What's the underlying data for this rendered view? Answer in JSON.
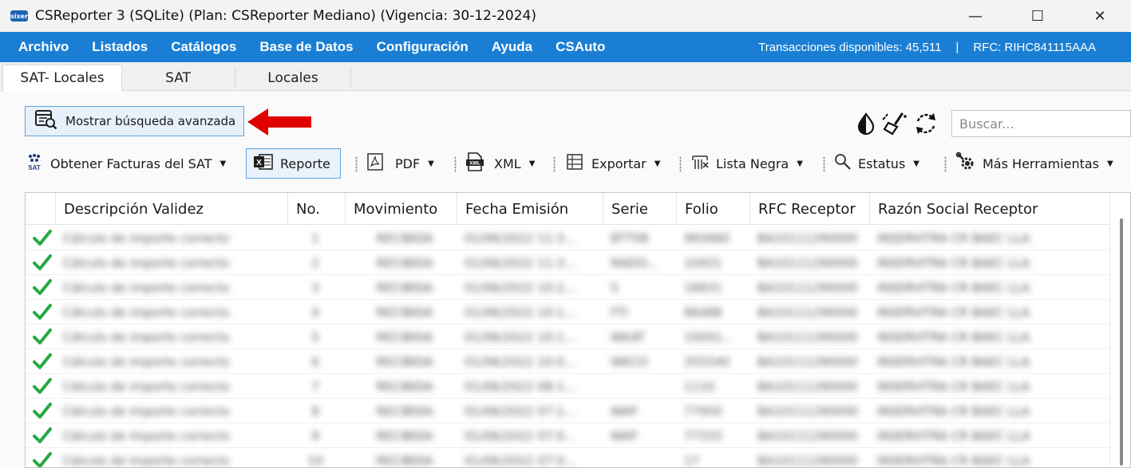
{
  "window": {
    "title": "CSReporter 3 (SQLite) (Plan: CSReporter Mediano) (Vigencia: 30-12-2024)",
    "logo_text": "sixer",
    "controls": {
      "minimize": "—",
      "maximize": "☐",
      "close": "✕"
    }
  },
  "menu": {
    "items": [
      "Archivo",
      "Listados",
      "Catálogos",
      "Base de Datos",
      "Configuración",
      "Ayuda",
      "CSAuto"
    ],
    "transactions": "Transacciones disponibles: 45,511",
    "separator": "|",
    "rfc": "RFC: RIHC841115AAA"
  },
  "tabs": [
    "SAT- Locales",
    "SAT",
    "Locales"
  ],
  "advanced_search": {
    "label": "Mostrar búsqueda avanzada"
  },
  "search": {
    "placeholder": "Buscar..."
  },
  "toolbar": {
    "obtener": "Obtener Facturas del SAT",
    "reporte": "Reporte",
    "pdf": "PDF",
    "xml": "XML",
    "exportar": "Exportar",
    "lista_negra": "Lista Negra",
    "estatus": "Estatus",
    "mas": "Más Herramientas"
  },
  "grid": {
    "columns": [
      "Descripción Validez",
      "No.",
      "Movimiento",
      "Fecha Emisión",
      "Serie",
      "Folio",
      "RFC Receptor",
      "Razón Social Receptor"
    ],
    "rows": [
      {
        "desc": "Cálculo de importe correcto",
        "no": "1",
        "mov": "RECIBIDA",
        "fecha": "01/06/2022 11:3...",
        "serie": "BTT08",
        "folio": "965660",
        "rfc": "BA10111290000",
        "razon": "INSERVITRA CR BAEC LLA"
      },
      {
        "desc": "Cálculo de importe correcto",
        "no": "2",
        "mov": "RECIBIDA",
        "fecha": "01/06/2022 11:3...",
        "serie": "RAEIO...",
        "folio": "10431",
        "rfc": "BA10111290000",
        "razon": "INSERVITRA CR BAEC LLA"
      },
      {
        "desc": "Cálculo de importe correcto",
        "no": "3",
        "mov": "RECIBIDA",
        "fecha": "01/06/2022 10:2...",
        "serie": "S",
        "folio": "16831",
        "rfc": "BA10111290000",
        "razon": "INSERVITRA CR BAEC LLA"
      },
      {
        "desc": "Cálculo de importe correcto",
        "no": "4",
        "mov": "RECIBIDA",
        "fecha": "01/06/2022 10:1...",
        "serie": "FTI",
        "folio": "86488",
        "rfc": "BA10111290000",
        "razon": "INSERVITRA CR BAEC LLA"
      },
      {
        "desc": "Cálculo de importe correcto",
        "no": "5",
        "mov": "RECIBIDA",
        "fecha": "01/06/2022 10:1...",
        "serie": "WAAT",
        "folio": "10001...",
        "rfc": "BA10111290000",
        "razon": "INSERVITRA CR BAEC LLA"
      },
      {
        "desc": "Cálculo de importe correcto",
        "no": "6",
        "mov": "RECIBIDA",
        "fecha": "01/06/2022 10:0...",
        "serie": "WECO",
        "folio": "355540",
        "rfc": "BA10111290000",
        "razon": "INSERVITRA CR BAEC LLA"
      },
      {
        "desc": "Cálculo de importe correcto",
        "no": "7",
        "mov": "RECIBIDA",
        "fecha": "01/06/2022 08:1...",
        "serie": "",
        "folio": "1110",
        "rfc": "BA10111290000",
        "razon": "INSERVITRA CR BAEC LLA"
      },
      {
        "desc": "Cálculo de importe correcto",
        "no": "8",
        "mov": "RECIBIDA",
        "fecha": "01/06/2022 07:1...",
        "serie": "WAP",
        "folio": "77950",
        "rfc": "BA10111290000",
        "razon": "INSERVITRA CR BAEC LLA"
      },
      {
        "desc": "Cálculo de importe correcto",
        "no": "9",
        "mov": "RECIBIDA",
        "fecha": "01/06/2022 07:0...",
        "serie": "WAP",
        "folio": "77333",
        "rfc": "BA10111290000",
        "razon": "INSERVITRA CR BAEC LLA"
      },
      {
        "desc": "Cálculo de importe correcto",
        "no": "10",
        "mov": "RECIBIDA",
        "fecha": "01/06/2022 07:0...",
        "serie": "",
        "folio": "17",
        "rfc": "BA10111290000",
        "razon": "INSERVITRA CR BAEC LLA"
      }
    ]
  },
  "colors": {
    "menubar": "#1a7fd4",
    "check": "#27a843",
    "arrow": "#e00000",
    "accent_border": "#5ba4e6"
  }
}
